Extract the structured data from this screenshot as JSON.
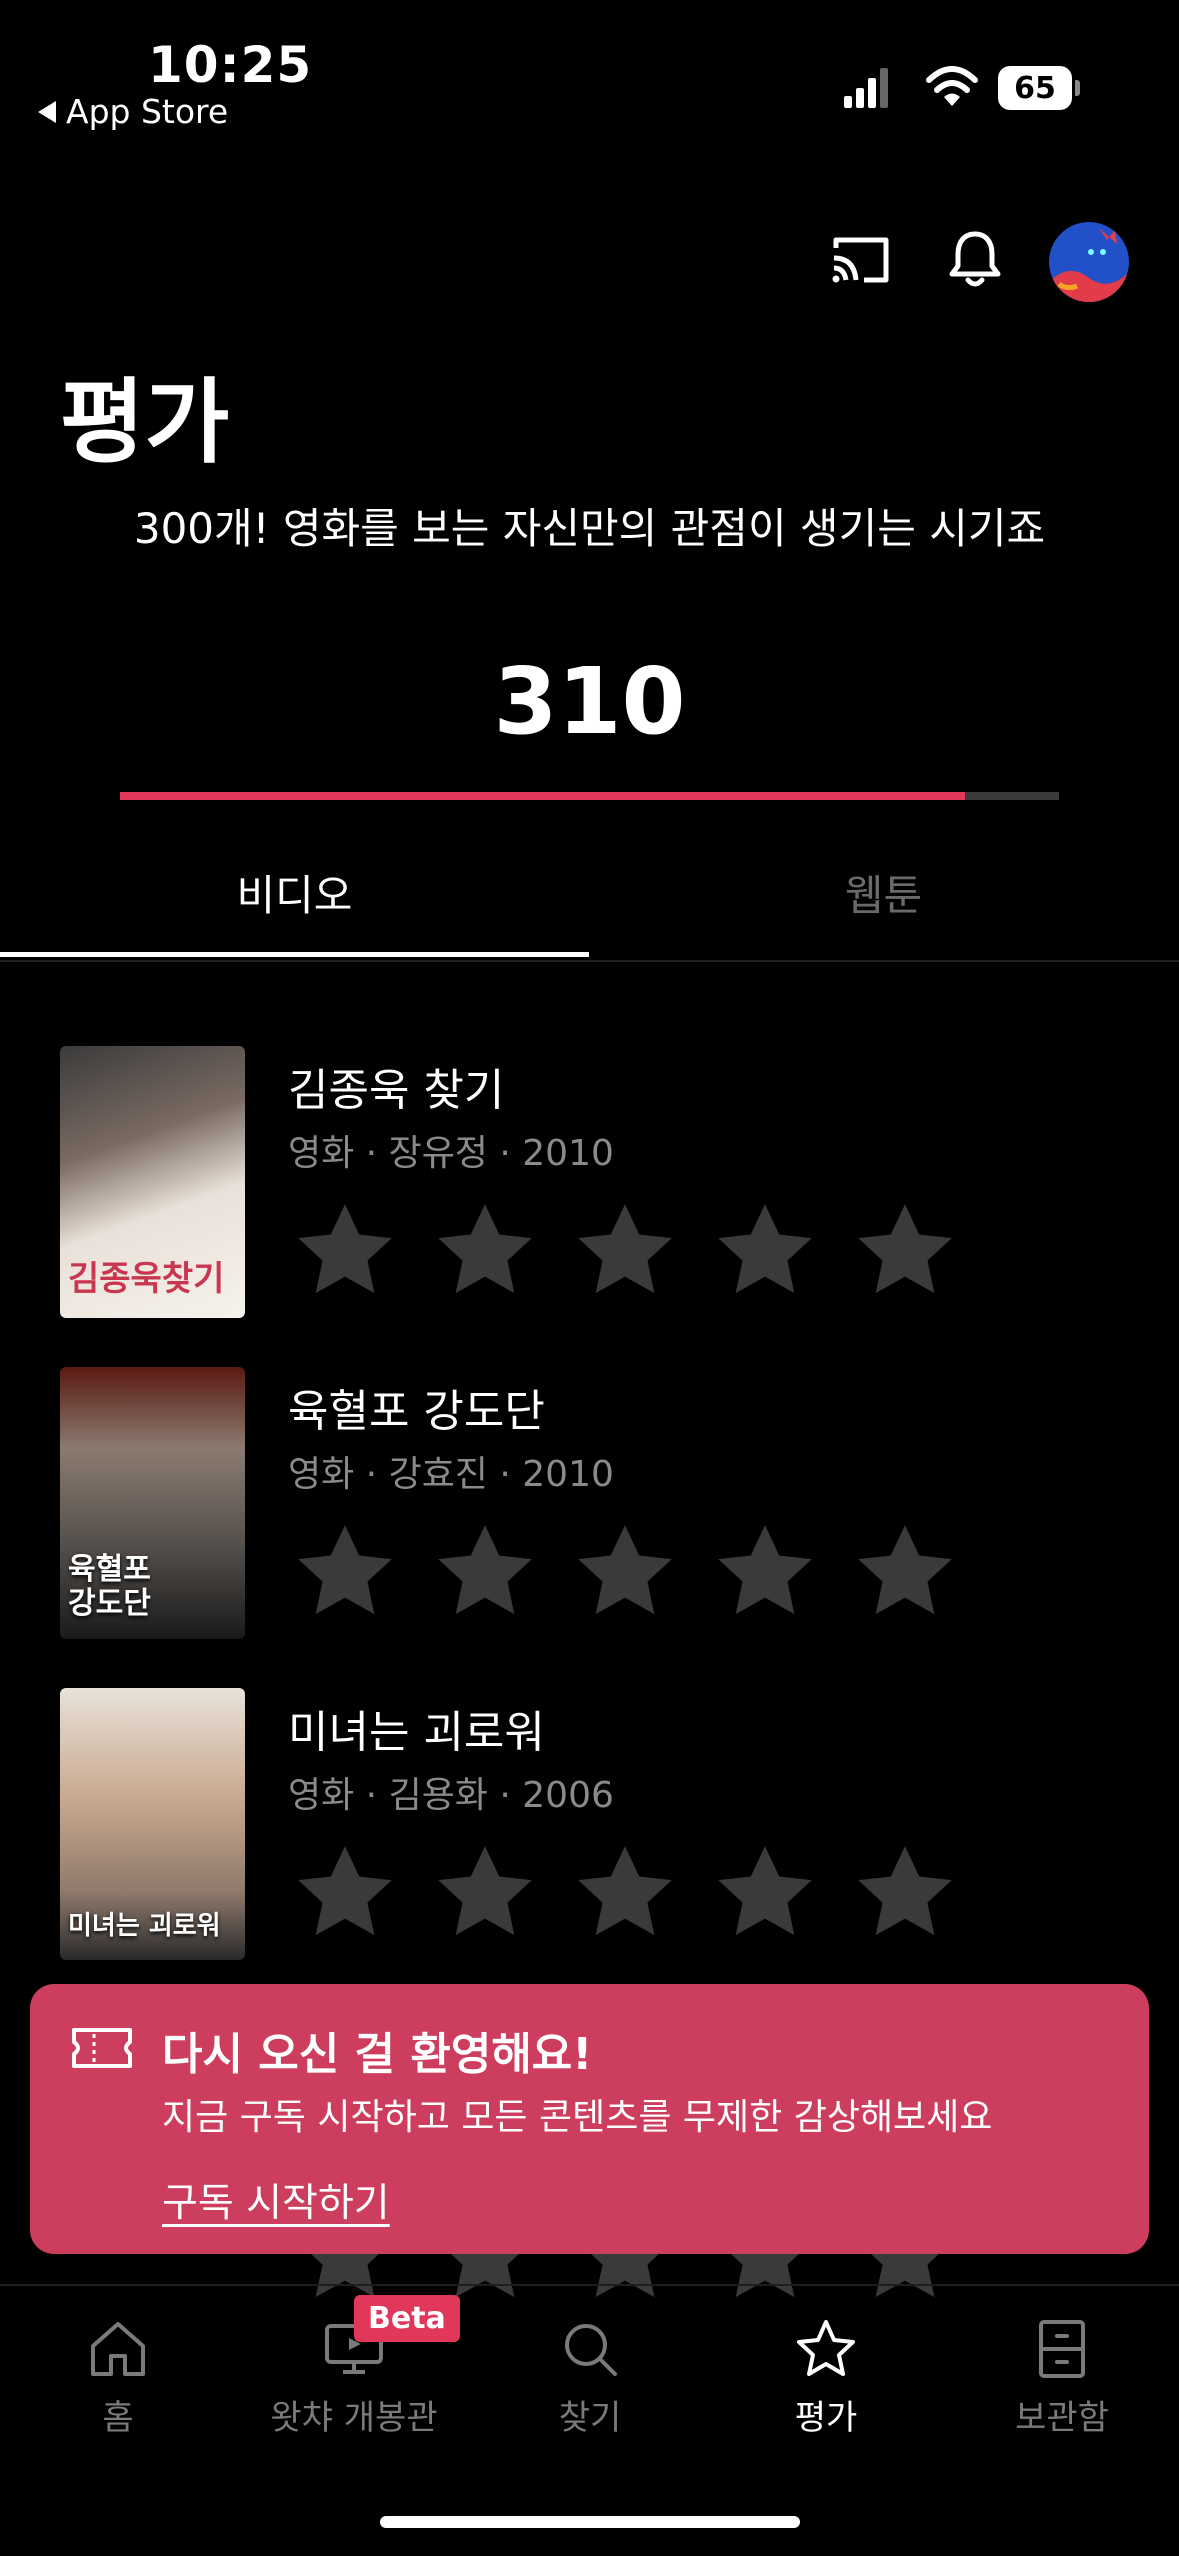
{
  "status_bar": {
    "time": "10:25",
    "back_label": "App Store",
    "battery": "65"
  },
  "header": {
    "title": "평가"
  },
  "rating_progress": {
    "message": "300개! 영화를 보는 자신만의 관점이 생기는 시기죠",
    "count": "310",
    "fill_fraction": 0.9,
    "accent_color": "#e1375a"
  },
  "tabs": [
    {
      "label": "비디오",
      "active": true
    },
    {
      "label": "웹툰",
      "active": false
    }
  ],
  "items": [
    {
      "title": "김종욱 찾기",
      "meta": "영화 · 장유정 · 2010",
      "rating": 0
    },
    {
      "title": "육혈포 강도단",
      "meta": "영화 · 강효진 · 2010",
      "rating": 0
    },
    {
      "title": "미녀는 괴로워",
      "meta": "영화 · 김용화 · 2006",
      "rating": 0
    }
  ],
  "posters": [
    {
      "text": "김종욱찾기"
    },
    {
      "text": "육혈포 강도단"
    },
    {
      "text": "미녀는 괴로워"
    }
  ],
  "toast": {
    "title": "다시 오신 걸 환영해요!",
    "body": "지금 구독 시작하고 모든 콘텐츠를 무제한 감상해보세요",
    "link": "구독 시작하기",
    "background": "#cc3d5e"
  },
  "bottom_nav": [
    {
      "label": "홈",
      "icon": "home-icon"
    },
    {
      "label": "왓챠 개봉관",
      "icon": "tv-icon",
      "badge": "Beta"
    },
    {
      "label": "찾기",
      "icon": "search-icon"
    },
    {
      "label": "평가",
      "icon": "star-icon",
      "active": true
    },
    {
      "label": "보관함",
      "icon": "cabinet-icon"
    }
  ]
}
